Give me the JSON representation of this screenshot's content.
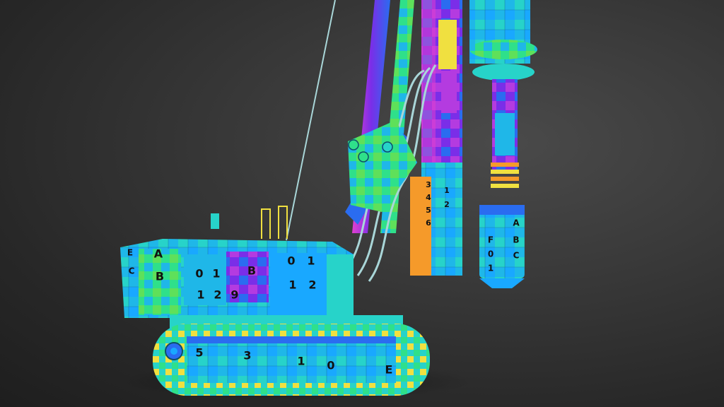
{
  "scene": {
    "subject": "drilling-rig-uv-checker-render",
    "background_color": "#333333",
    "checker_palette": [
      "#1fb7e8",
      "#27d3c9",
      "#2fe08a",
      "#5fe05a",
      "#b7e84a",
      "#f0e040",
      "#f59a2a",
      "#7a2ee8",
      "#b43be0",
      "#e040d0",
      "#2a6cf0",
      "#19a8ff"
    ],
    "cable_color": "#a9d6d8",
    "uv_labels": {
      "body_row1": [
        "E",
        "A",
        "0",
        "1",
        "B",
        "0",
        "1"
      ],
      "body_row2": [
        "C",
        "B",
        "1",
        "2",
        "9",
        "1",
        "2"
      ],
      "track": [
        "5",
        "3",
        "1",
        "0",
        "E"
      ],
      "mast": [
        "3",
        "4",
        "5",
        "6",
        "1",
        "2"
      ],
      "auger": [
        "A",
        "B",
        "C",
        "F",
        "0",
        "1"
      ]
    }
  }
}
